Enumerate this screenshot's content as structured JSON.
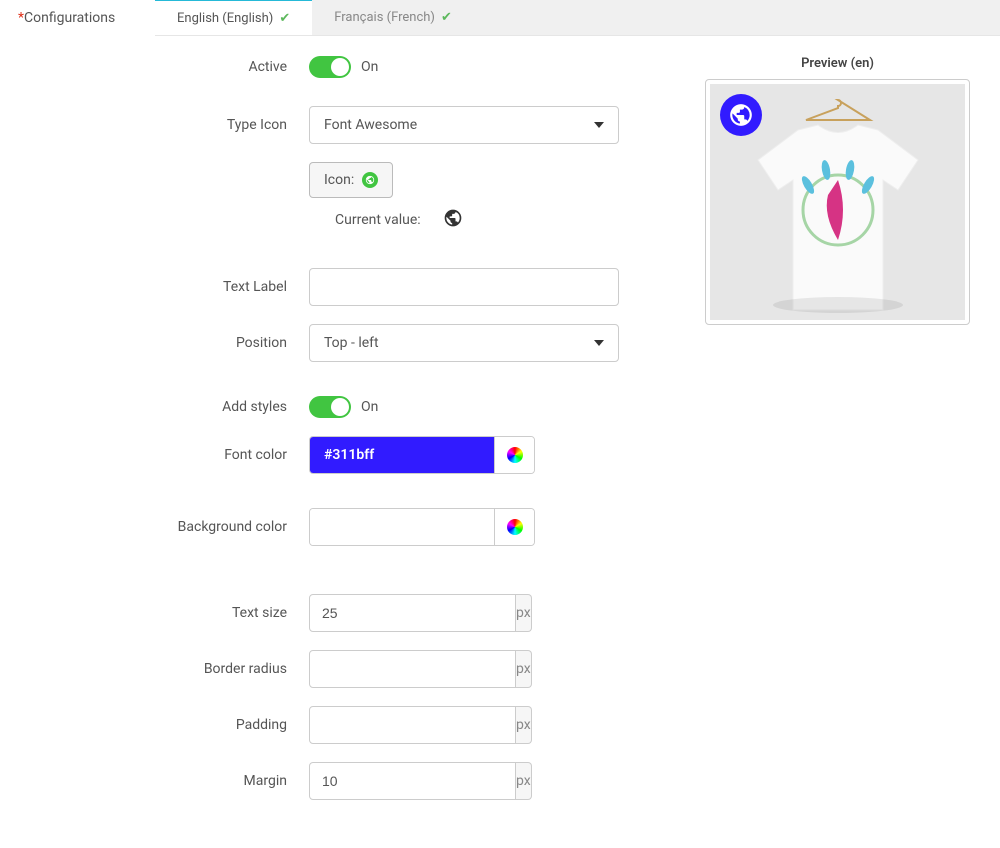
{
  "sidebar": {
    "title": "Configurations"
  },
  "tabs": [
    {
      "label": "English (English)",
      "active": true
    },
    {
      "label": "Français (French)",
      "active": false
    }
  ],
  "form": {
    "active": {
      "label": "Active",
      "state": "On"
    },
    "typeIcon": {
      "label": "Type Icon",
      "selected": "Font Awesome",
      "iconButton": "Icon:",
      "currentValueLabel": "Current value:"
    },
    "textLabel": {
      "label": "Text Label",
      "value": ""
    },
    "position": {
      "label": "Position",
      "selected": "Top - left"
    },
    "addStyles": {
      "label": "Add styles",
      "state": "On"
    },
    "fontColor": {
      "label": "Font color",
      "value": "#311bff"
    },
    "backgroundColor": {
      "label": "Background color",
      "value": ""
    },
    "textSize": {
      "label": "Text size",
      "value": "25",
      "unit": "px"
    },
    "borderRadius": {
      "label": "Border radius",
      "value": "",
      "unit": "px"
    },
    "padding": {
      "label": "Padding",
      "value": "",
      "unit": "px"
    },
    "margin": {
      "label": "Margin",
      "value": "10",
      "unit": "px"
    }
  },
  "preview": {
    "title": "Preview (en)",
    "badgeColor": "#311bff"
  }
}
